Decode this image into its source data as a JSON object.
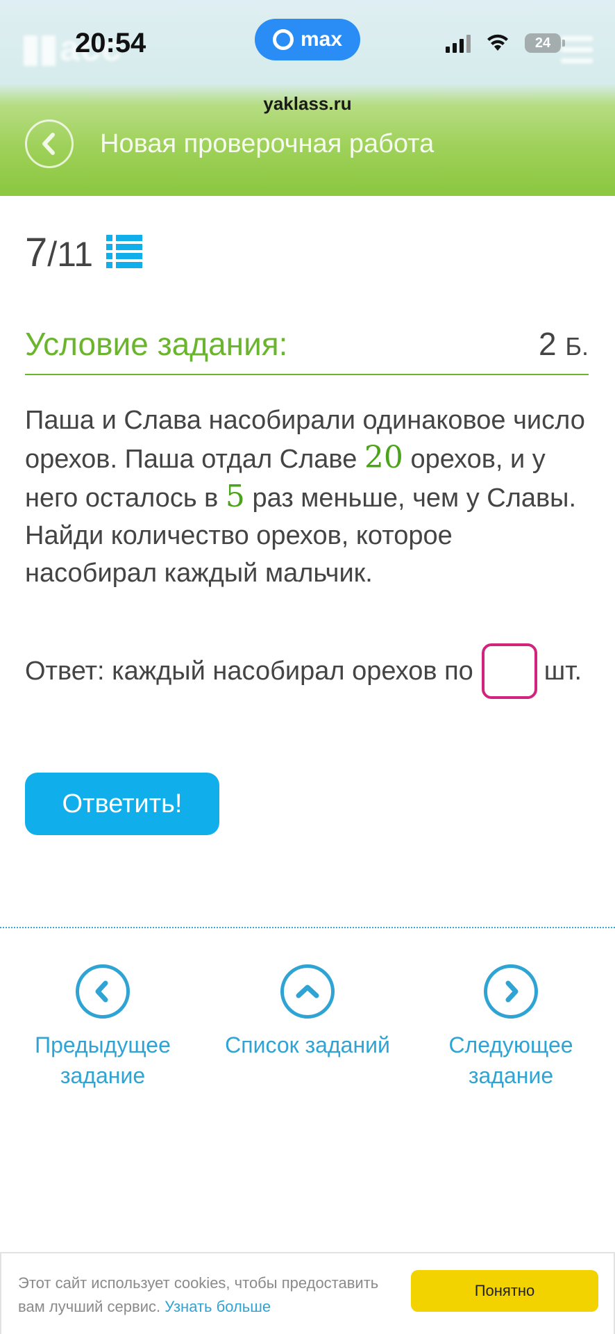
{
  "status_bar": {
    "time": "20:54",
    "max_label": "max",
    "battery": "24"
  },
  "browser": {
    "url": "yaklass.ru"
  },
  "header": {
    "title": "Новая проверочная работа"
  },
  "progress": {
    "current": "7",
    "total": "/11"
  },
  "task": {
    "section_title": "Условие задания:",
    "points_value": "2",
    "points_unit": "Б.",
    "text_part1": "Паша и Слава насобирали одинаковое число орехов. Паша отдал Славе ",
    "num1": "20",
    "text_part2": " орехов, и у него осталось в ",
    "num2": "5",
    "text_part3": " раз меньше, чем у Славы. Найди количество  орехов, которое насобирал каждый мальчик."
  },
  "answer": {
    "prefix": "Ответ:  каждый насобирал орехов по",
    "value": "",
    "suffix": "шт."
  },
  "submit_label": "Ответить!",
  "navigation": {
    "prev_line1": "Предыдущее",
    "prev_line2": "задание",
    "list": "Список заданий",
    "next_line1": "Следующее",
    "next_line2": "задание"
  },
  "cookie": {
    "text": "Этот сайт использует cookies, чтобы предоставить вам лучший сервис. ",
    "link": "Узнать больше",
    "button": "Понятно"
  },
  "colors": {
    "accent_green": "#6bb52e",
    "accent_blue": "#10aeea",
    "answer_border": "#d3247d",
    "cookie_button": "#f2d300"
  }
}
